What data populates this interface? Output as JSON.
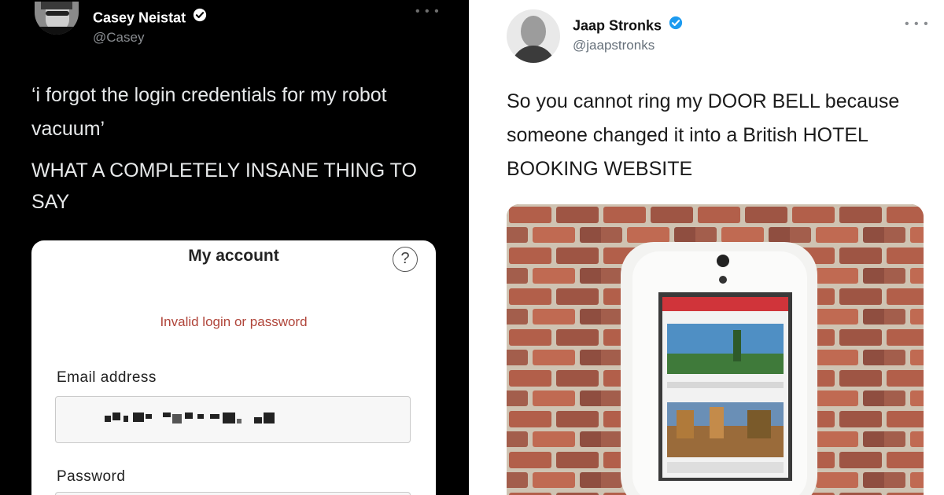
{
  "left_tweet": {
    "name": "Casey Neistat",
    "handle": "@Casey",
    "text_line1": "‘i forgot the login credentials for my robot vacuum’",
    "text_line2": "WHAT A COMPLETELY INSANE THING TO SAY",
    "card": {
      "title": "My account",
      "help_glyph": "?",
      "error": "Invalid login or password",
      "email_label": "Email address",
      "password_label": "Password"
    }
  },
  "right_tweet": {
    "name": "Jaap Stronks",
    "handle": "@jaapstronks",
    "text": "So you cannot ring my DOOR BELL because someone changed it into a British HOTEL BOOKING WEBSITE"
  },
  "icons": {
    "verified": "verified-badge-icon",
    "more": "more-options-icon",
    "help": "help-icon"
  },
  "colors": {
    "verified_blue": "#1d9bf0",
    "error_red": "#b0453a",
    "dark_bg": "#000000",
    "booking_red": "#d0343a"
  }
}
